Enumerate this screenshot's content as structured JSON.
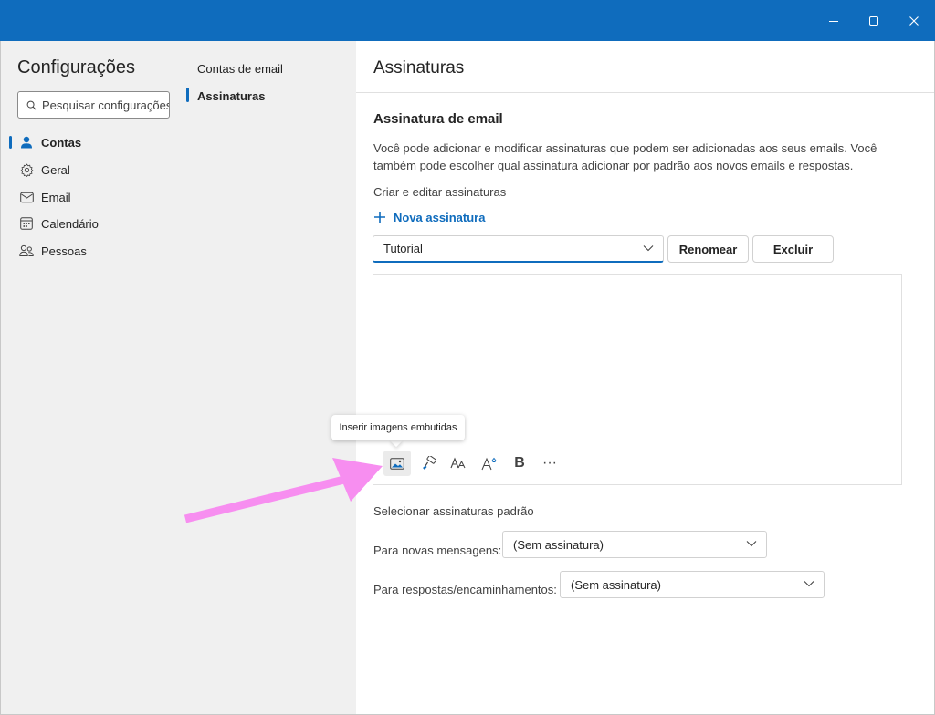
{
  "window": {
    "minimize_icon": "minimize-icon",
    "maximize_icon": "maximize-icon",
    "close_icon": "close-icon",
    "titlebar_color": "#0f6cbd"
  },
  "sidebar": {
    "title": "Configurações",
    "search_placeholder": "Pesquisar configurações",
    "items": [
      {
        "label": "Contas",
        "icon": "person-icon",
        "active": true
      },
      {
        "label": "Geral",
        "icon": "gear-icon",
        "active": false
      },
      {
        "label": "Email",
        "icon": "mail-icon",
        "active": false
      },
      {
        "label": "Calendário",
        "icon": "calendar-icon",
        "active": false
      },
      {
        "label": "Pessoas",
        "icon": "people-icon",
        "active": false
      }
    ]
  },
  "subnav": {
    "items": [
      {
        "label": "Contas de email",
        "active": false
      },
      {
        "label": "Assinaturas",
        "active": true
      }
    ]
  },
  "main": {
    "title": "Assinaturas",
    "section_title": "Assinatura de email",
    "description": "Você pode adicionar e modificar assinaturas que podem ser adicionadas aos seus emails. Você também pode escolher qual assinatura adicionar por padrão aos novos emails e respostas.",
    "create_label": "Criar e editar assinaturas",
    "new_signature": "Nova assinatura",
    "selected_signature": "Tutorial",
    "rename_button": "Renomear",
    "delete_button": "Excluir",
    "tooltip": "Inserir imagens embutidas",
    "toolbar_icons": [
      "image-icon",
      "format-painter-icon",
      "font-size-icon",
      "superscript-icon",
      "bold-icon",
      "more-icon"
    ],
    "bold_glyph": "B",
    "more_glyph": "···",
    "defaults_label": "Selecionar assinaturas padrão",
    "new_messages_label": "Para novas mensagens:",
    "new_messages_value": "(Sem assinatura)",
    "replies_label": "Para respostas/encaminhamentos:",
    "replies_value": "(Sem assinatura)"
  },
  "annotation": {
    "arrow_color": "#f78ef0"
  },
  "colors": {
    "accent": "#0f6cbd",
    "sidebar_bg": "#f0f0f0"
  }
}
